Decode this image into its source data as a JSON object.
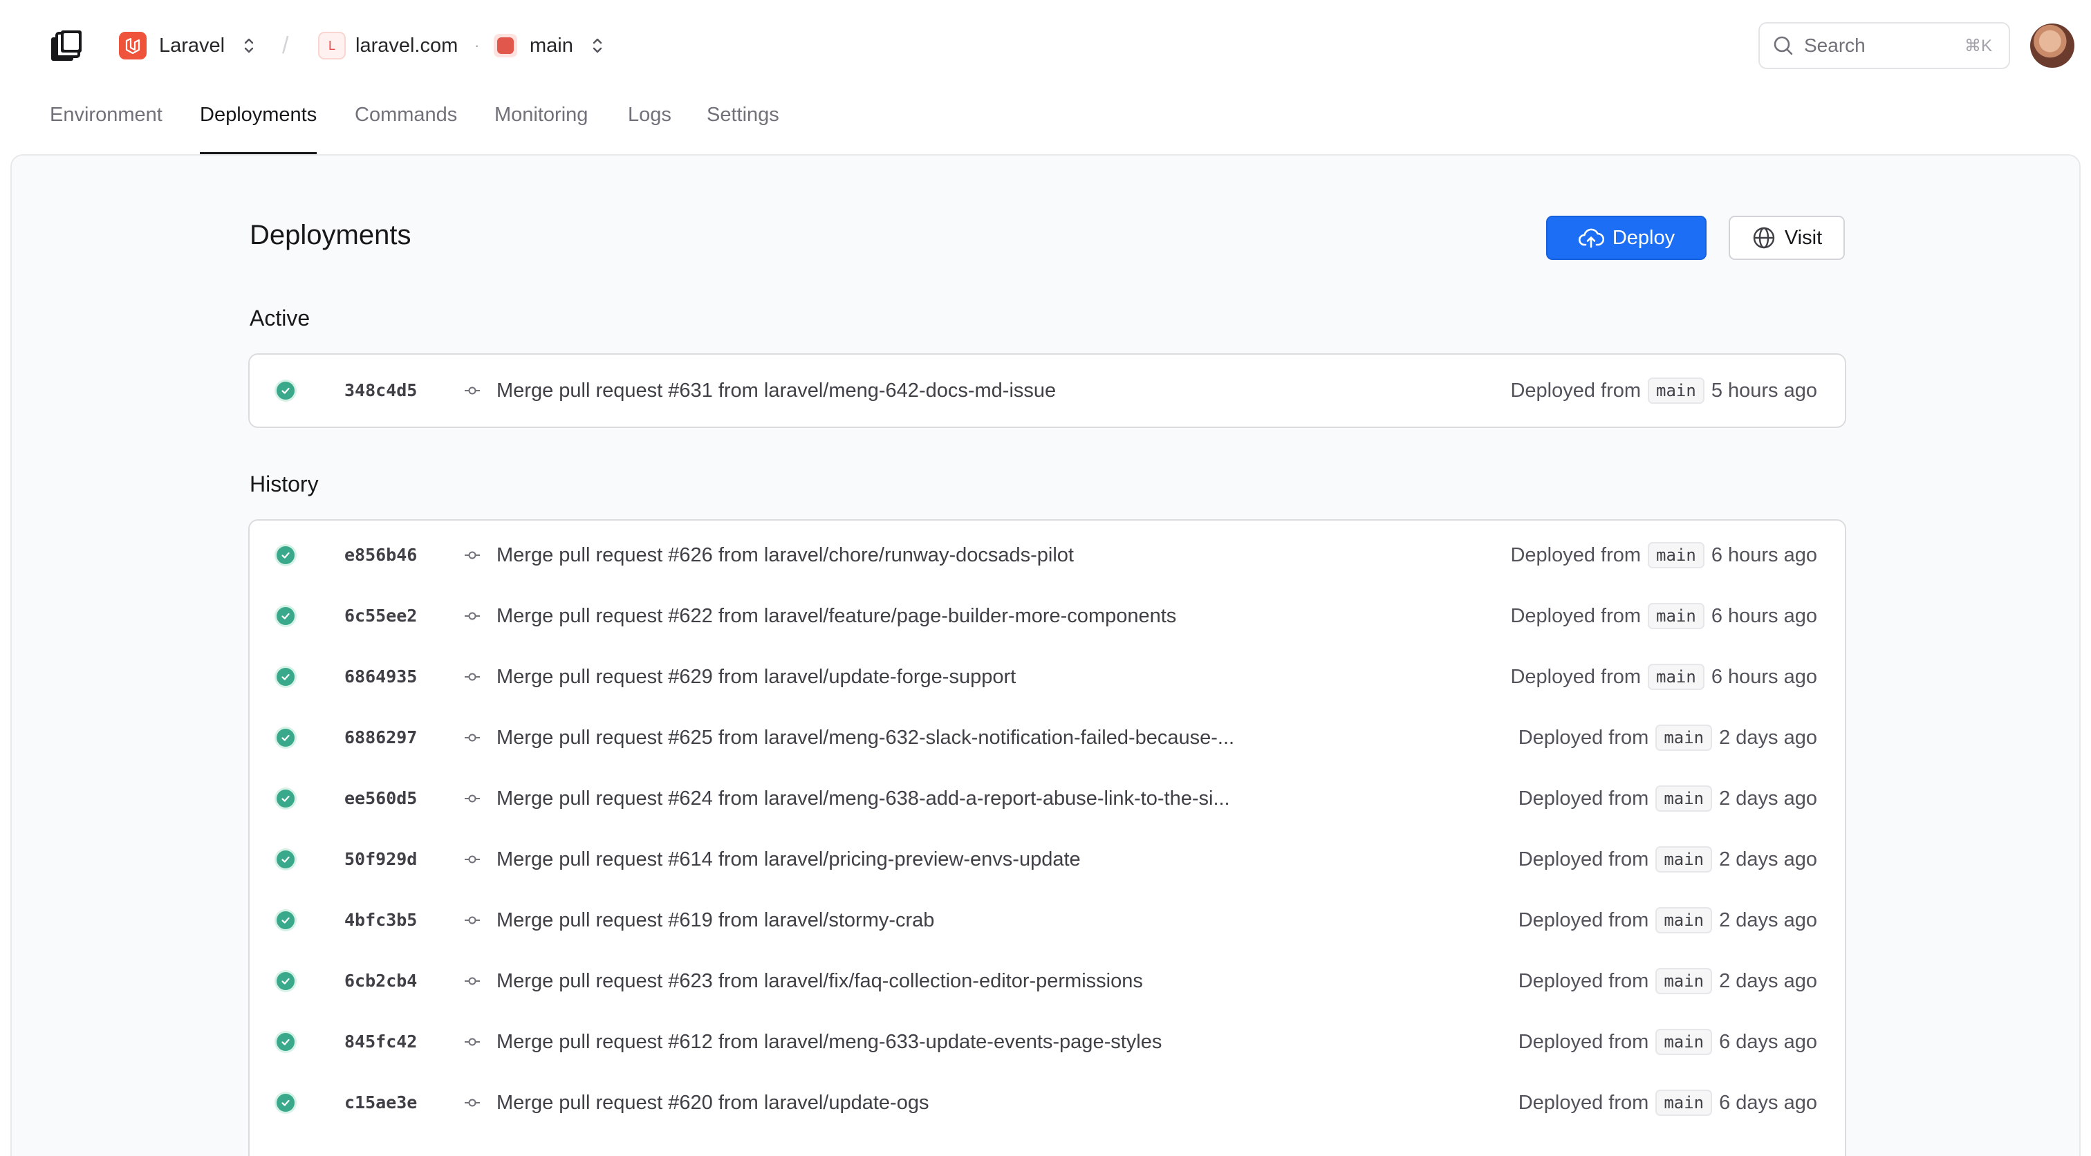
{
  "breadcrumb": {
    "org": "Laravel",
    "separator": "/",
    "project_initial": "L",
    "project": "laravel.com",
    "dot": "·",
    "environment": "main"
  },
  "search": {
    "placeholder": "Search",
    "shortcut": "⌘K"
  },
  "tabs": [
    {
      "label": "Environment"
    },
    {
      "label": "Deployments",
      "active": true
    },
    {
      "label": "Commands"
    },
    {
      "label": "Monitoring"
    },
    {
      "label": "Logs"
    },
    {
      "label": "Settings"
    }
  ],
  "page": {
    "title": "Deployments",
    "deploy_label": "Deploy",
    "visit_label": "Visit",
    "active_title": "Active",
    "history_title": "History"
  },
  "active": [
    {
      "sha": "348c4d5",
      "message": "Merge pull request #631 from laravel/meng-642-docs-md-issue",
      "prefix": "Deployed from",
      "branch": "main",
      "time": "5 hours ago"
    }
  ],
  "history": [
    {
      "sha": "e856b46",
      "message": "Merge pull request #626 from laravel/chore/runway-docsads-pilot",
      "prefix": "Deployed from",
      "branch": "main",
      "time": "6 hours ago"
    },
    {
      "sha": "6c55ee2",
      "message": "Merge pull request #622 from laravel/feature/page-builder-more-components",
      "prefix": "Deployed from",
      "branch": "main",
      "time": "6 hours ago"
    },
    {
      "sha": "6864935",
      "message": "Merge pull request #629 from laravel/update-forge-support",
      "prefix": "Deployed from",
      "branch": "main",
      "time": "6 hours ago"
    },
    {
      "sha": "6886297",
      "message": "Merge pull request #625 from laravel/meng-632-slack-notification-failed-because-...",
      "prefix": "Deployed from",
      "branch": "main",
      "time": "2 days ago"
    },
    {
      "sha": "ee560d5",
      "message": "Merge pull request #624 from laravel/meng-638-add-a-report-abuse-link-to-the-si...",
      "prefix": "Deployed from",
      "branch": "main",
      "time": "2 days ago"
    },
    {
      "sha": "50f929d",
      "message": "Merge pull request #614 from laravel/pricing-preview-envs-update",
      "prefix": "Deployed from",
      "branch": "main",
      "time": "2 days ago"
    },
    {
      "sha": "4bfc3b5",
      "message": "Merge pull request #619 from laravel/stormy-crab",
      "prefix": "Deployed from",
      "branch": "main",
      "time": "2 days ago"
    },
    {
      "sha": "6cb2cb4",
      "message": "Merge pull request #623 from laravel/fix/faq-collection-editor-permissions",
      "prefix": "Deployed from",
      "branch": "main",
      "time": "2 days ago"
    },
    {
      "sha": "845fc42",
      "message": "Merge pull request #612 from laravel/meng-633-update-events-page-styles",
      "prefix": "Deployed from",
      "branch": "main",
      "time": "6 days ago"
    },
    {
      "sha": "c15ae3e",
      "message": "Merge pull request #620 from laravel/update-ogs",
      "prefix": "Deployed from",
      "branch": "main",
      "time": "6 days ago"
    }
  ],
  "colors": {
    "accent": "#1c6ff5",
    "success": "#3aa88a",
    "brand": "#f0533b"
  }
}
